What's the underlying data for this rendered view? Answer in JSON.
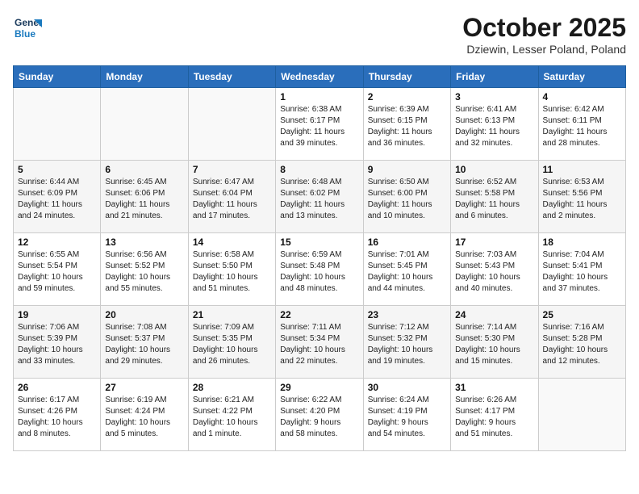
{
  "header": {
    "logo_line1": "General",
    "logo_line2": "Blue",
    "month_title": "October 2025",
    "location": "Dziewin, Lesser Poland, Poland"
  },
  "weekdays": [
    "Sunday",
    "Monday",
    "Tuesday",
    "Wednesday",
    "Thursday",
    "Friday",
    "Saturday"
  ],
  "weeks": [
    [
      {
        "day": "",
        "content": ""
      },
      {
        "day": "",
        "content": ""
      },
      {
        "day": "",
        "content": ""
      },
      {
        "day": "1",
        "content": "Sunrise: 6:38 AM\nSunset: 6:17 PM\nDaylight: 11 hours\nand 39 minutes."
      },
      {
        "day": "2",
        "content": "Sunrise: 6:39 AM\nSunset: 6:15 PM\nDaylight: 11 hours\nand 36 minutes."
      },
      {
        "day": "3",
        "content": "Sunrise: 6:41 AM\nSunset: 6:13 PM\nDaylight: 11 hours\nand 32 minutes."
      },
      {
        "day": "4",
        "content": "Sunrise: 6:42 AM\nSunset: 6:11 PM\nDaylight: 11 hours\nand 28 minutes."
      }
    ],
    [
      {
        "day": "5",
        "content": "Sunrise: 6:44 AM\nSunset: 6:09 PM\nDaylight: 11 hours\nand 24 minutes."
      },
      {
        "day": "6",
        "content": "Sunrise: 6:45 AM\nSunset: 6:06 PM\nDaylight: 11 hours\nand 21 minutes."
      },
      {
        "day": "7",
        "content": "Sunrise: 6:47 AM\nSunset: 6:04 PM\nDaylight: 11 hours\nand 17 minutes."
      },
      {
        "day": "8",
        "content": "Sunrise: 6:48 AM\nSunset: 6:02 PM\nDaylight: 11 hours\nand 13 minutes."
      },
      {
        "day": "9",
        "content": "Sunrise: 6:50 AM\nSunset: 6:00 PM\nDaylight: 11 hours\nand 10 minutes."
      },
      {
        "day": "10",
        "content": "Sunrise: 6:52 AM\nSunset: 5:58 PM\nDaylight: 11 hours\nand 6 minutes."
      },
      {
        "day": "11",
        "content": "Sunrise: 6:53 AM\nSunset: 5:56 PM\nDaylight: 11 hours\nand 2 minutes."
      }
    ],
    [
      {
        "day": "12",
        "content": "Sunrise: 6:55 AM\nSunset: 5:54 PM\nDaylight: 10 hours\nand 59 minutes."
      },
      {
        "day": "13",
        "content": "Sunrise: 6:56 AM\nSunset: 5:52 PM\nDaylight: 10 hours\nand 55 minutes."
      },
      {
        "day": "14",
        "content": "Sunrise: 6:58 AM\nSunset: 5:50 PM\nDaylight: 10 hours\nand 51 minutes."
      },
      {
        "day": "15",
        "content": "Sunrise: 6:59 AM\nSunset: 5:48 PM\nDaylight: 10 hours\nand 48 minutes."
      },
      {
        "day": "16",
        "content": "Sunrise: 7:01 AM\nSunset: 5:45 PM\nDaylight: 10 hours\nand 44 minutes."
      },
      {
        "day": "17",
        "content": "Sunrise: 7:03 AM\nSunset: 5:43 PM\nDaylight: 10 hours\nand 40 minutes."
      },
      {
        "day": "18",
        "content": "Sunrise: 7:04 AM\nSunset: 5:41 PM\nDaylight: 10 hours\nand 37 minutes."
      }
    ],
    [
      {
        "day": "19",
        "content": "Sunrise: 7:06 AM\nSunset: 5:39 PM\nDaylight: 10 hours\nand 33 minutes."
      },
      {
        "day": "20",
        "content": "Sunrise: 7:08 AM\nSunset: 5:37 PM\nDaylight: 10 hours\nand 29 minutes."
      },
      {
        "day": "21",
        "content": "Sunrise: 7:09 AM\nSunset: 5:35 PM\nDaylight: 10 hours\nand 26 minutes."
      },
      {
        "day": "22",
        "content": "Sunrise: 7:11 AM\nSunset: 5:34 PM\nDaylight: 10 hours\nand 22 minutes."
      },
      {
        "day": "23",
        "content": "Sunrise: 7:12 AM\nSunset: 5:32 PM\nDaylight: 10 hours\nand 19 minutes."
      },
      {
        "day": "24",
        "content": "Sunrise: 7:14 AM\nSunset: 5:30 PM\nDaylight: 10 hours\nand 15 minutes."
      },
      {
        "day": "25",
        "content": "Sunrise: 7:16 AM\nSunset: 5:28 PM\nDaylight: 10 hours\nand 12 minutes."
      }
    ],
    [
      {
        "day": "26",
        "content": "Sunrise: 6:17 AM\nSunset: 4:26 PM\nDaylight: 10 hours\nand 8 minutes."
      },
      {
        "day": "27",
        "content": "Sunrise: 6:19 AM\nSunset: 4:24 PM\nDaylight: 10 hours\nand 5 minutes."
      },
      {
        "day": "28",
        "content": "Sunrise: 6:21 AM\nSunset: 4:22 PM\nDaylight: 10 hours\nand 1 minute."
      },
      {
        "day": "29",
        "content": "Sunrise: 6:22 AM\nSunset: 4:20 PM\nDaylight: 9 hours\nand 58 minutes."
      },
      {
        "day": "30",
        "content": "Sunrise: 6:24 AM\nSunset: 4:19 PM\nDaylight: 9 hours\nand 54 minutes."
      },
      {
        "day": "31",
        "content": "Sunrise: 6:26 AM\nSunset: 4:17 PM\nDaylight: 9 hours\nand 51 minutes."
      },
      {
        "day": "",
        "content": ""
      }
    ]
  ]
}
